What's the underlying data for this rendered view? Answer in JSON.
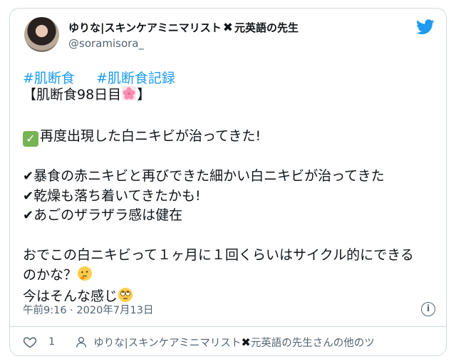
{
  "tweet": {
    "display_name": "ゆりな|スキンケアミニマリスト",
    "name_suffix": "元英語の先生",
    "handle": "@soramisora_",
    "hashtags": [
      "#肌断食",
      "#肌断食記録"
    ],
    "lines": [
      "【肌断食98日目",
      "】",
      "再度出現した白ニキビが治ってきた!",
      "暴食の赤ニキビと再びできた細かい白ニキビが治ってきた",
      "乾燥も落ち着いてきたかも!",
      "あごのザラザラ感は健在",
      "おでこの白ニキビって１ヶ月に１回くらいはサイクル的にできる",
      "のかな？",
      "今はそんな感じ"
    ],
    "timestamp": "午前9:16 · 2020年7月13日",
    "like_count": "1",
    "more_from": "ゆりな|スキンケアミニマリスト",
    "more_from_suffix": "元英語の先生さんの他のツ",
    "check_mark": "✔",
    "x_mark": "✖"
  },
  "colors": {
    "link": "#1d9bf0",
    "muted": "#536471",
    "border": "#cfd9de",
    "check_green": "#77b255"
  },
  "icons": {
    "bird": "twitter-bird-icon",
    "heart": "heart-icon",
    "user": "user-icon",
    "info": "info-icon"
  }
}
